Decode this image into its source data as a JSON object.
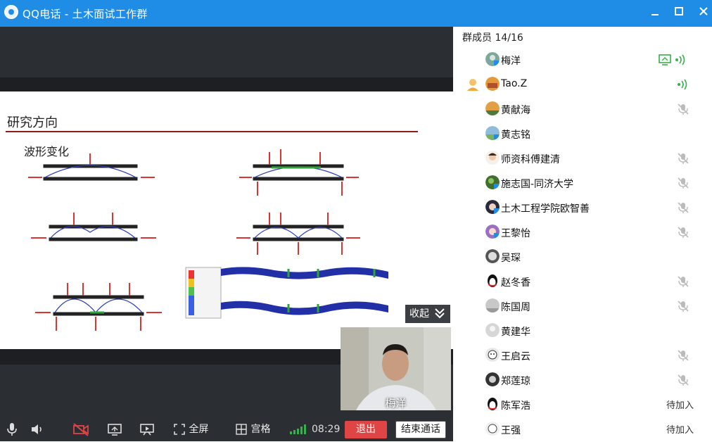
{
  "window": {
    "title": "QQ电话 - 土木面试工作群",
    "app_logo": "qq-call-logo"
  },
  "slide": {
    "heading": "研究方向",
    "subheading": "波形变化",
    "accent_color": "#8c1c1c"
  },
  "collapse_label": "收起",
  "camera": {
    "name": "梅洋"
  },
  "controls": {
    "fullscreen_label": "全屏",
    "grid_label": "宫格",
    "timer": "08:29",
    "exit_label": "退出",
    "end_call_label": "结束通话"
  },
  "members": {
    "header": "群成员 14/16",
    "list": [
      {
        "name": "梅洋",
        "state": "speaking-screen"
      },
      {
        "name": "Tao.Z",
        "state": "speaking",
        "host": true
      },
      {
        "name": "黄献海",
        "state": "muted"
      },
      {
        "name": "黄志铭",
        "state": "none"
      },
      {
        "name": "师资科傅建清",
        "state": "muted"
      },
      {
        "name": "施志国-同济大学",
        "state": "muted"
      },
      {
        "name": "土木工程学院欧智善",
        "state": "muted"
      },
      {
        "name": "王黎怡",
        "state": "muted"
      },
      {
        "name": "吴琛",
        "state": "none"
      },
      {
        "name": "赵冬香",
        "state": "muted"
      },
      {
        "name": "陈国周",
        "state": "muted"
      },
      {
        "name": "黄建华",
        "state": "none"
      },
      {
        "name": "王启云",
        "state": "muted"
      },
      {
        "name": "郑莲琼",
        "state": "muted"
      },
      {
        "name": "陈军浩",
        "state": "pending",
        "status": "待加入"
      },
      {
        "name": "王强",
        "state": "pending",
        "status": "待加入"
      }
    ]
  },
  "colors": {
    "titlebar": "#1f8de6",
    "speaking": "#33b14a",
    "exit": "#e04545"
  }
}
